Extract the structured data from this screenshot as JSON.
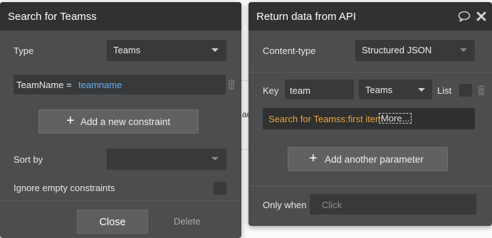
{
  "search_panel": {
    "title": "Search for Teamss",
    "type_label": "Type",
    "type_value": "Teams",
    "constraint_field": "TeamName =",
    "constraint_value": "teamname",
    "add_constraint_label": "Add a new constraint",
    "sort_by_label": "Sort by",
    "sort_by_value": "",
    "ignore_empty_label": "Ignore empty constraints",
    "close_label": "Close",
    "delete_label": "Delete"
  },
  "api_panel": {
    "title": "Return data from API",
    "content_type_label": "Content-type",
    "content_type_value": "Structured JSON",
    "key_label": "Key",
    "key_value": "team",
    "key_type_value": "Teams",
    "list_label": "List",
    "expression_text": "Search for Teamss:first item",
    "more_label": "More...",
    "add_parameter_label": "Add another parameter",
    "only_when_label": "Only when",
    "only_when_placeholder": "Click"
  },
  "background": {
    "partial_text": "ac"
  },
  "colors": {
    "panel": "#4b4d4e",
    "header": "#2f3133",
    "field": "#37393a",
    "accent_blue": "#6aaef0",
    "accent_orange": "#f0a43a"
  },
  "icons": [
    "plus-icon",
    "trash-icon",
    "chevron-down-icon",
    "comment-icon",
    "close-icon"
  ]
}
